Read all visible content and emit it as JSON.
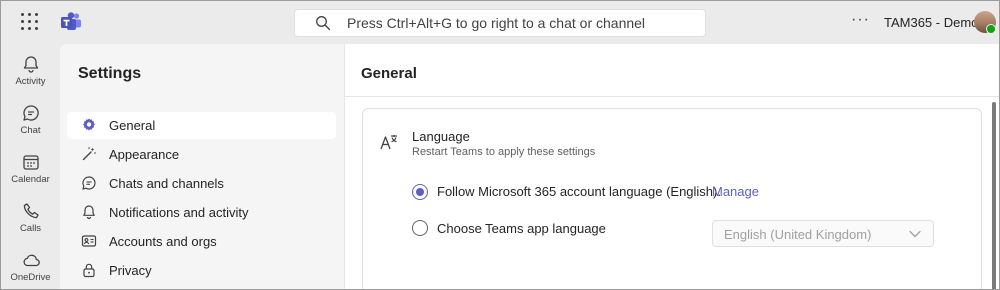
{
  "titlebar": {
    "search_placeholder": "Press Ctrl+Alt+G to go right to a chat or channel",
    "more_label": "···",
    "account_name": "TAM365 - Demo1"
  },
  "rail": [
    {
      "label": "Activity",
      "icon": "bell-icon"
    },
    {
      "label": "Chat",
      "icon": "chat-icon"
    },
    {
      "label": "Calendar",
      "icon": "calendar-icon"
    },
    {
      "label": "Calls",
      "icon": "phone-icon"
    },
    {
      "label": "OneDrive",
      "icon": "cloud-icon"
    }
  ],
  "settings": {
    "title": "Settings",
    "items": [
      {
        "label": "General",
        "icon": "gear-icon",
        "active": true
      },
      {
        "label": "Appearance",
        "icon": "wand-icon"
      },
      {
        "label": "Chats and channels",
        "icon": "chat-icon"
      },
      {
        "label": "Notifications and activity",
        "icon": "bell-icon"
      },
      {
        "label": "Accounts and orgs",
        "icon": "id-card-icon"
      },
      {
        "label": "Privacy",
        "icon": "lock-icon"
      }
    ]
  },
  "main": {
    "title": "General",
    "language": {
      "title": "Language",
      "subtitle": "Restart Teams to apply these settings",
      "option_follow": "Follow Microsoft 365 account language (English).",
      "manage_link": "Manage",
      "option_choose": "Choose Teams app language",
      "dropdown_value": "English (United Kingdom)",
      "selected": "follow"
    }
  },
  "colors": {
    "accent": "#5b5fc7",
    "presence": "#13a10e"
  }
}
